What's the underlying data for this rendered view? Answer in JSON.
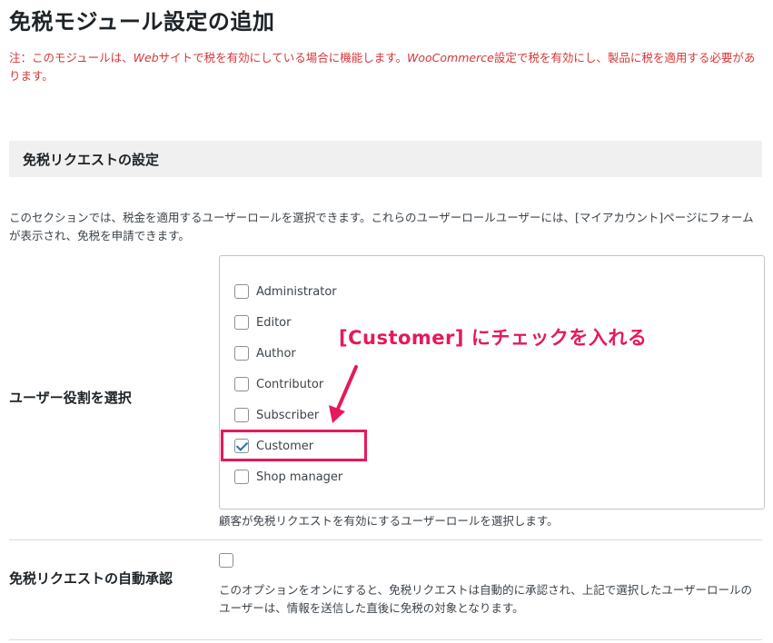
{
  "page": {
    "title": "免税モジュール設定の追加"
  },
  "notice": {
    "part1": "注：このモジュールは、",
    "part2": "Web",
    "part3": "サイトで税を有効にしている場合に機能します。",
    "part4": "WooCommerce",
    "part5": "設定で税を有効にし、製品に税を適用する必要があります。"
  },
  "section": {
    "title": "免税リクエストの設定",
    "description": "このセクションでは、税金を適用するユーザーロールを選択できます。これらのユーザーロールユーザーには、[マイアカウント]ページにフォームが表示され、免税を申請できます。"
  },
  "roles": {
    "label": "ユーザー役割を選択",
    "items": [
      {
        "label": "Administrator",
        "checked": false
      },
      {
        "label": "Editor",
        "checked": false
      },
      {
        "label": "Author",
        "checked": false
      },
      {
        "label": "Contributor",
        "checked": false
      },
      {
        "label": "Subscriber",
        "checked": false
      },
      {
        "label": "Customer",
        "checked": true
      },
      {
        "label": "Shop manager",
        "checked": false
      }
    ],
    "hint": "顧客が免税リクエストを有効にするユーザーロールを選択します。"
  },
  "annotation": {
    "text": "[Customer] にチェックを入れる",
    "color": "#e6195a"
  },
  "auto_approve": {
    "label": "免税リクエストの自動承認",
    "checked": false,
    "description": "このオプションをオンにすると、免税リクエストは自動的に承認され、上記で選択したユーザーロールのユーザーは、情報を送信した直後に免税の対象となります。"
  }
}
